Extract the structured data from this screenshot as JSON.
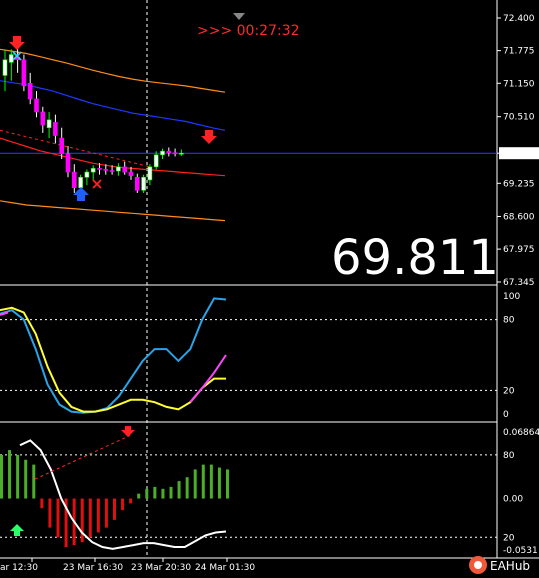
{
  "countdown": ">>> 00:27:32",
  "big_price": "69.811",
  "watermark": "EAHub",
  "colors": {
    "bg": "#000000",
    "axis": "#ffffff",
    "bull": "#00ff00",
    "bear": "#ff00ff",
    "hist_up": "#4caf2a",
    "hist_down": "#e01010",
    "env_outer": "#ff8c1a",
    "env_inner": "#ff2020",
    "ma": "#1e38ff",
    "current_price": "#2d3cff",
    "stoch_main": "#2aa4e8",
    "stoch_signal": "#ffff33",
    "stoch_magenta": "#ff44ff",
    "signal_down": "#ff2222",
    "signal_up": "#1e60ff",
    "cross": "#33ccff",
    "white_line": "#ffffff"
  },
  "chart_data": [
    {
      "type": "candlestick",
      "panel": "price",
      "y_ticks": [
        "72.400",
        "71.775",
        "71.150",
        "70.510",
        "69.811",
        "69.235",
        "68.600",
        "67.975",
        "67.345"
      ],
      "ylim": [
        67.345,
        72.4
      ],
      "current_price": 69.811,
      "x_ticks": [
        "ar 12:30",
        "23 Mar 16:30",
        "23 Mar 20:30",
        "24 Mar 01:30"
      ],
      "candles": [
        {
          "o": 71.3,
          "h": 71.8,
          "l": 71.0,
          "c": 71.6
        },
        {
          "o": 71.55,
          "h": 71.8,
          "l": 71.2,
          "c": 71.7
        },
        {
          "o": 71.65,
          "h": 71.85,
          "l": 71.35,
          "c": 71.6
        },
        {
          "o": 71.6,
          "h": 71.7,
          "l": 71.0,
          "c": 71.1
        },
        {
          "o": 71.15,
          "h": 71.35,
          "l": 70.75,
          "c": 70.85
        },
        {
          "o": 70.85,
          "h": 71.0,
          "l": 70.5,
          "c": 70.6
        },
        {
          "o": 70.6,
          "h": 70.7,
          "l": 70.2,
          "c": 70.35
        },
        {
          "o": 70.3,
          "h": 70.6,
          "l": 70.1,
          "c": 70.45
        },
        {
          "o": 70.4,
          "h": 70.55,
          "l": 70.0,
          "c": 70.15
        },
        {
          "o": 70.1,
          "h": 70.3,
          "l": 69.7,
          "c": 69.8
        },
        {
          "o": 69.8,
          "h": 69.95,
          "l": 69.35,
          "c": 69.45
        },
        {
          "o": 69.45,
          "h": 69.6,
          "l": 69.05,
          "c": 69.15
        },
        {
          "o": 69.15,
          "h": 69.4,
          "l": 69.05,
          "c": 69.35
        },
        {
          "o": 69.35,
          "h": 69.5,
          "l": 69.2,
          "c": 69.45
        },
        {
          "o": 69.45,
          "h": 69.58,
          "l": 69.3,
          "c": 69.52
        },
        {
          "o": 69.52,
          "h": 69.62,
          "l": 69.4,
          "c": 69.5
        },
        {
          "o": 69.5,
          "h": 69.6,
          "l": 69.4,
          "c": 69.48
        },
        {
          "o": 69.48,
          "h": 69.58,
          "l": 69.4,
          "c": 69.47
        },
        {
          "o": 69.47,
          "h": 69.62,
          "l": 69.38,
          "c": 69.55
        },
        {
          "o": 69.55,
          "h": 69.65,
          "l": 69.4,
          "c": 69.45
        },
        {
          "o": 69.45,
          "h": 69.55,
          "l": 69.3,
          "c": 69.38
        },
        {
          "o": 69.35,
          "h": 69.42,
          "l": 69.05,
          "c": 69.1
        },
        {
          "o": 69.1,
          "h": 69.4,
          "l": 69.05,
          "c": 69.35
        },
        {
          "o": 69.3,
          "h": 69.6,
          "l": 69.2,
          "c": 69.55
        },
        {
          "o": 69.55,
          "h": 69.85,
          "l": 69.5,
          "c": 69.78
        },
        {
          "o": 69.78,
          "h": 69.9,
          "l": 69.7,
          "c": 69.85
        },
        {
          "o": 69.85,
          "h": 69.92,
          "l": 69.75,
          "c": 69.82
        },
        {
          "o": 69.82,
          "h": 69.9,
          "l": 69.75,
          "c": 69.81
        },
        {
          "o": 69.81,
          "h": 69.88,
          "l": 69.76,
          "c": 69.81
        }
      ],
      "envelope_upper_outer": [
        71.8,
        71.76,
        71.72,
        71.66,
        71.6,
        71.54,
        71.47,
        71.4,
        71.34,
        71.28,
        71.23,
        71.19,
        71.16,
        71.13,
        71.1,
        71.06,
        71.02,
        70.98
      ],
      "ma": [
        71.2,
        71.16,
        71.12,
        71.06,
        71.0,
        70.92,
        70.84,
        70.76,
        70.7,
        70.64,
        70.58,
        70.54,
        70.5,
        70.46,
        70.42,
        70.36,
        70.3,
        70.25
      ],
      "envelope_inner_lower": [
        70.1,
        70.02,
        69.94,
        69.86,
        69.8,
        69.74,
        69.68,
        69.62,
        69.58,
        69.54,
        69.52,
        69.5,
        69.48,
        69.46,
        69.44,
        69.42,
        69.4,
        69.38
      ],
      "envelope_lower_outer": [
        68.9,
        68.86,
        68.82,
        68.8,
        68.78,
        68.76,
        68.74,
        68.72,
        68.7,
        68.68,
        68.66,
        68.64,
        68.62,
        68.6,
        68.58,
        68.56,
        68.54,
        68.52
      ]
    },
    {
      "type": "line",
      "panel": "stochastic",
      "y_ticks": [
        "100",
        "80",
        "20",
        "0"
      ],
      "ylim": [
        0,
        100
      ],
      "series": [
        {
          "values": [
            85,
            88,
            80,
            55,
            25,
            8,
            2,
            1,
            2,
            5,
            15,
            30,
            45,
            55,
            55,
            45,
            55,
            80,
            98,
            97
          ]
        },
        {
          "values": [
            88,
            90,
            86,
            68,
            40,
            18,
            6,
            2,
            2,
            4,
            8,
            12,
            12,
            10,
            6,
            4,
            10,
            22,
            30,
            30
          ]
        }
      ]
    },
    {
      "type": "bar",
      "panel": "histogram",
      "y_ticks": [
        "0.06864",
        "80",
        "0.00",
        "20",
        "-0.0531"
      ],
      "ylim": [
        -0.0531,
        0.06864
      ],
      "values": [
        0.045,
        0.05,
        0.045,
        0.04,
        0.035,
        -0.01,
        -0.03,
        -0.04,
        -0.05,
        -0.048,
        -0.045,
        -0.04,
        -0.035,
        -0.03,
        -0.022,
        -0.012,
        -0.005,
        0.005,
        0.01,
        0.012,
        0.01,
        0.012,
        0.018,
        0.022,
        0.03,
        0.035,
        0.035,
        0.032,
        0.03
      ]
    }
  ]
}
